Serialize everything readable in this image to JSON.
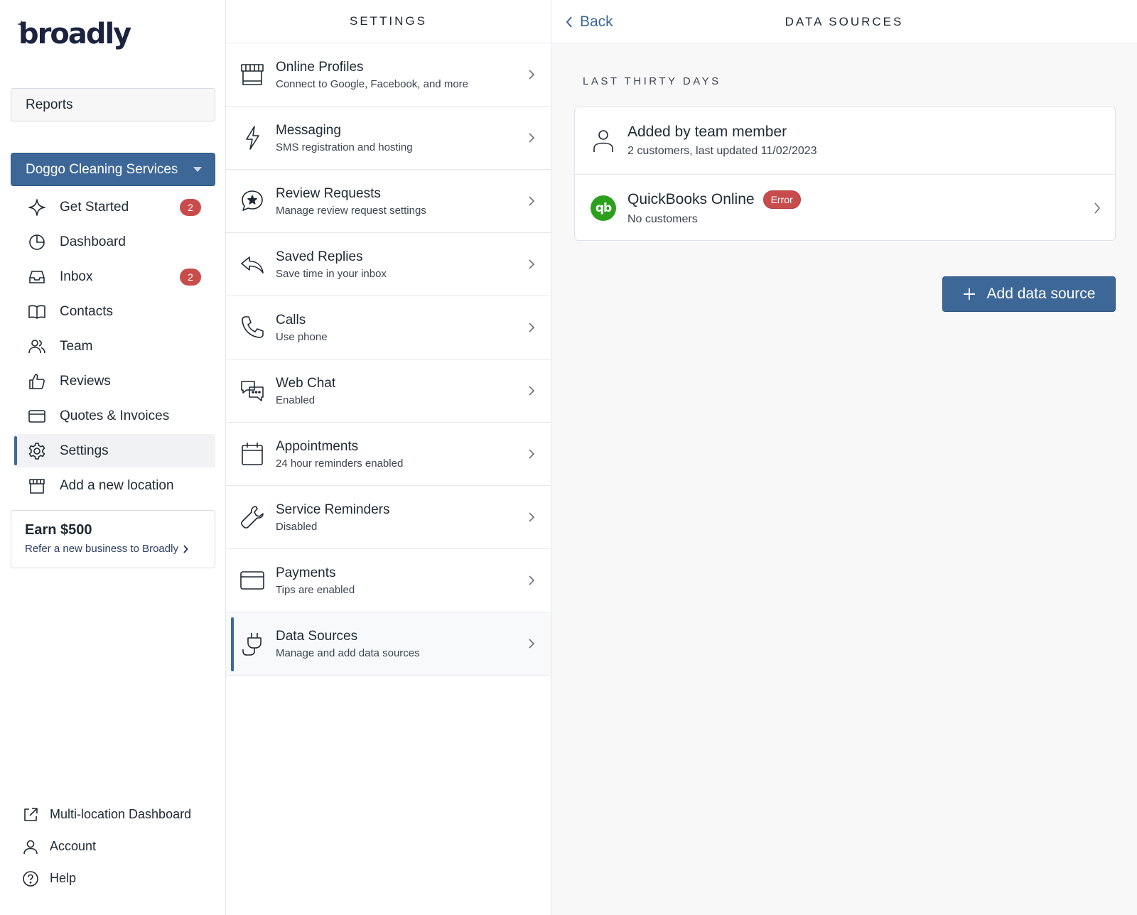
{
  "brand": {
    "logo_text": "broadly"
  },
  "sidebar": {
    "reports_label": "Reports",
    "location": {
      "name": "Doggo Cleaning Services"
    },
    "nav": [
      {
        "label": "Get Started",
        "icon": "sparkle-icon",
        "badge": "2"
      },
      {
        "label": "Dashboard",
        "icon": "pie-chart-icon"
      },
      {
        "label": "Inbox",
        "icon": "inbox-icon",
        "badge": "2"
      },
      {
        "label": "Contacts",
        "icon": "book-icon"
      },
      {
        "label": "Team",
        "icon": "team-icon"
      },
      {
        "label": "Reviews",
        "icon": "thumbs-up-icon"
      },
      {
        "label": "Quotes & Invoices",
        "icon": "card-icon"
      },
      {
        "label": "Settings",
        "icon": "gear-icon",
        "active": true
      },
      {
        "label": "Add a new location",
        "icon": "storefront-icon"
      }
    ],
    "promo": {
      "title": "Earn $500",
      "link": "Refer a new business to Broadly"
    },
    "bottom": [
      {
        "label": "Multi-location Dashboard",
        "icon": "external-link-icon"
      },
      {
        "label": "Account",
        "icon": "user-icon"
      },
      {
        "label": "Help",
        "icon": "help-icon"
      }
    ]
  },
  "settings": {
    "header": "SETTINGS",
    "items": [
      {
        "title": "Online Profiles",
        "subtitle": "Connect to Google, Facebook, and more",
        "icon": "storefront-icon"
      },
      {
        "title": "Messaging",
        "subtitle": "SMS registration and hosting",
        "icon": "lightning-icon"
      },
      {
        "title": "Review Requests",
        "subtitle": "Manage review request settings",
        "icon": "star-chat-icon"
      },
      {
        "title": "Saved Replies",
        "subtitle": "Save time in your inbox",
        "icon": "reply-icon"
      },
      {
        "title": "Calls",
        "subtitle": "Use phone",
        "icon": "phone-icon"
      },
      {
        "title": "Web Chat",
        "subtitle": "Enabled",
        "icon": "chat-bubbles-icon"
      },
      {
        "title": "Appointments",
        "subtitle": "24 hour reminders enabled",
        "icon": "calendar-icon"
      },
      {
        "title": "Service Reminders",
        "subtitle": "Disabled",
        "icon": "wrench-icon"
      },
      {
        "title": "Payments",
        "subtitle": "Tips are enabled",
        "icon": "card-icon"
      },
      {
        "title": "Data Sources",
        "subtitle": "Manage and add data sources",
        "icon": "plug-icon",
        "active": true
      }
    ]
  },
  "detail": {
    "back_label": "Back",
    "title": "DATA SOURCES",
    "section_label": "LAST THIRTY DAYS",
    "sources": [
      {
        "title": "Added by team member",
        "subtitle": "2 customers, last updated 11/02/2023",
        "icon": "user-icon"
      },
      {
        "title": "QuickBooks Online",
        "badge": "Error",
        "subtitle": "No customers",
        "icon": "quickbooks-logo",
        "logo_text": "qb",
        "brand_color": "#2ca01c"
      }
    ],
    "add_button_label": "Add data source"
  },
  "colors": {
    "accent": "#3d6796",
    "error": "#c84c4c",
    "quickbooks": "#2ca01c"
  }
}
